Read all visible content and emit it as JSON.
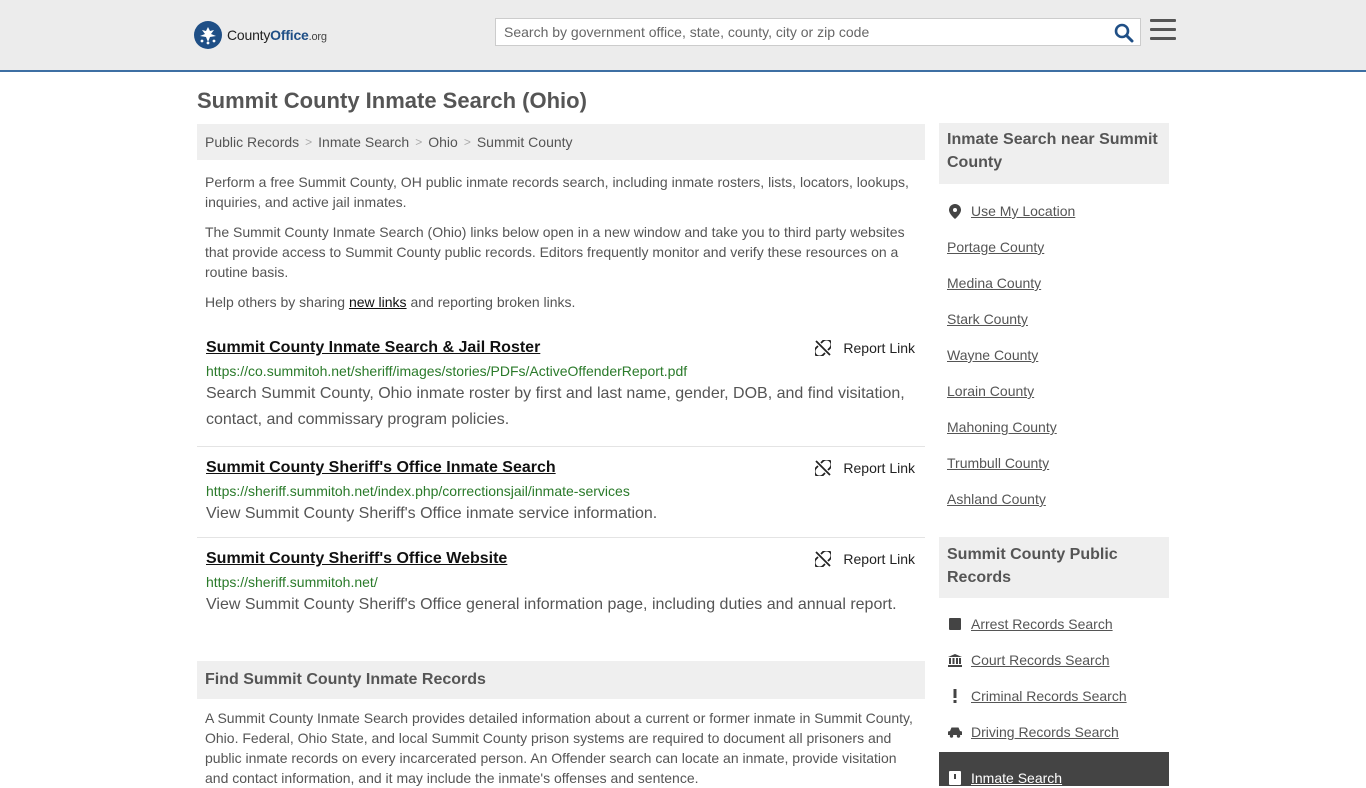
{
  "header": {
    "logo_main": "County",
    "logo_bold": "Office",
    "logo_suffix": ".org",
    "search_placeholder": "Search by government office, state, county, city or zip code",
    "search_icon": "search-icon",
    "menu_icon": "hamburger-menu-icon"
  },
  "page": {
    "title": "Summit County Inmate Search (Ohio)"
  },
  "breadcrumb": [
    "Public Records",
    "Inmate Search",
    "Ohio",
    "Summit County"
  ],
  "intro": {
    "p1": "Perform a free Summit County, OH public inmate records search, including inmate rosters, lists, locators, lookups, inquiries, and active jail inmates.",
    "p2": "The Summit County Inmate Search (Ohio) links below open in a new window and take you to third party websites that provide access to Summit County public records. Editors frequently monitor and verify these resources on a routine basis.",
    "p3_before": "Help others by sharing ",
    "p3_link": "new links",
    "p3_after": " and reporting broken links."
  },
  "entries": [
    {
      "title": "Summit County Inmate Search & Jail Roster",
      "url": "https://co.summitoh.net/sheriff/images/stories/PDFs/ActiveOffenderReport.pdf",
      "desc": "Search Summit County, Ohio inmate roster by first and last name, gender, DOB, and find visitation, contact, and commissary program policies.",
      "report": "Report Link"
    },
    {
      "title": "Summit County Sheriff's Office Inmate Search",
      "url": "https://sheriff.summitoh.net/index.php/correctionsjail/inmate-services",
      "desc": "View Summit County Sheriff's Office inmate service information.",
      "report": "Report Link"
    },
    {
      "title": "Summit County Sheriff's Office Website",
      "url": "https://sheriff.summitoh.net/",
      "desc": "View Summit County Sheriff's Office general information page, including duties and annual report.",
      "report": "Report Link"
    }
  ],
  "find": {
    "heading": "Find Summit County Inmate Records",
    "text": "A Summit County Inmate Search provides detailed information about a current or former inmate in Summit County, Ohio. Federal, Ohio State, and local Summit County prison systems are required to document all prisoners and public inmate records on every incarcerated person. An Offender search can locate an inmate, provide visitation and contact information, and it may include the inmate's offenses and sentence."
  },
  "sidebar": {
    "nearby_heading": "Inmate Search near Summit County",
    "nearby": [
      {
        "label": "Use My Location",
        "icon": "map-pin-icon"
      },
      {
        "label": "Portage County"
      },
      {
        "label": "Medina County"
      },
      {
        "label": "Stark County"
      },
      {
        "label": "Wayne County"
      },
      {
        "label": "Lorain County"
      },
      {
        "label": "Mahoning County"
      },
      {
        "label": "Trumbull County"
      },
      {
        "label": "Ashland County"
      }
    ],
    "records_heading": "Summit County Public Records",
    "records": [
      {
        "label": "Arrest Records Search",
        "icon": "square-icon"
      },
      {
        "label": "Court Records Search",
        "icon": "courthouse-icon"
      },
      {
        "label": "Criminal Records Search",
        "icon": "exclamation-icon"
      },
      {
        "label": "Driving Records Search",
        "icon": "car-icon"
      },
      {
        "label": "Inmate Search",
        "icon": "inmate-icon",
        "active": true
      }
    ]
  }
}
